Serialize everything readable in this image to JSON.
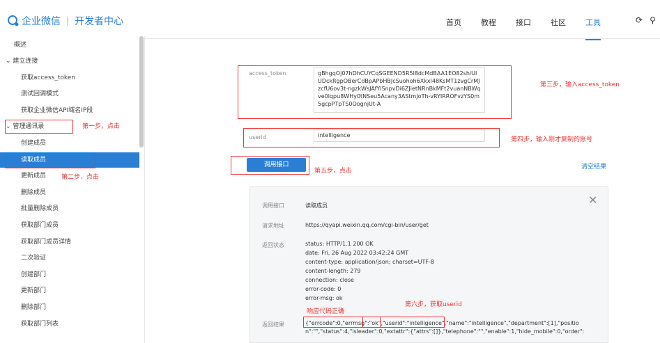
{
  "header": {
    "brand": "企业微信",
    "product": "开发者中心",
    "nav": [
      "首页",
      "教程",
      "接口",
      "社区",
      "工具"
    ],
    "active_nav": "工具"
  },
  "sidebar": {
    "items": [
      {
        "label": "概述",
        "level": 0
      },
      {
        "label": "建立连接",
        "level": "group",
        "chevron": "⌄"
      },
      {
        "label": "获取access_token",
        "level": 1
      },
      {
        "label": "测试回调模式",
        "level": 1
      },
      {
        "label": "获取企业微信API域名IP段",
        "level": 1
      },
      {
        "label": "管理通讯录",
        "level": "group",
        "chevron": "⌄"
      },
      {
        "label": "创建成员",
        "level": 1
      },
      {
        "label": "读取成员",
        "level": 1,
        "active": true
      },
      {
        "label": "更新成员",
        "level": 1
      },
      {
        "label": "删除成员",
        "level": 1
      },
      {
        "label": "批量删除成员",
        "level": 1
      },
      {
        "label": "获取部门成员",
        "level": 1
      },
      {
        "label": "获取部门成员详情",
        "level": 1
      },
      {
        "label": "二次验证",
        "level": 1
      },
      {
        "label": "创建部门",
        "level": 1
      },
      {
        "label": "更新部门",
        "level": 1
      },
      {
        "label": "删除部门",
        "level": 1
      },
      {
        "label": "获取部门列表",
        "level": 1
      }
    ]
  },
  "form": {
    "access_token_label": "access_token",
    "access_token_value": "gBhgqOj07hDhCUYCqSGEEND5R5l8dcMdBAA1EO82shiUIUDckRgpOBerCdBpAPbHBJcSuohoh6Xkxl48KsMT1zvgCrMJzcfU6ov3t-ngzkWsJAfYlSnpvDi6ZJietNRnBkMFt2vuanNBWqve0lqpu8WHy0tNSeu5Acany3AStmJoTh-vRYIRROFvzYS0m5gcpPTpTS0OognjUt-A",
    "userid_label": "userid",
    "userid_value": "intelligence",
    "debug_button": "调用接口",
    "clear_link": "清空结果"
  },
  "annotations": {
    "step1": "第一步，点击",
    "step2": "第二步，点击",
    "step3": "第三步，输入access_token",
    "step4": "第四步，输入刚才复制的账号",
    "step5": "第五步，点击",
    "step6": "第六步，获取userid",
    "result_ok": "响应代码正确"
  },
  "result": {
    "api_label": "调用接口",
    "api_value": "读取成员",
    "url_label": "请求地址",
    "url_value": "https://qyapi.weixin.qq.com/cgi-bin/user/get",
    "status_label": "返回状态",
    "status_lines": [
      "status: HTTP/1.1 200 OK",
      "date: Fri, 26 Aug 2022 03:42:24 GMT",
      "content-type: application/json; charset=UTF-8",
      "content-length: 279",
      "connection: close",
      "error-code: 0",
      "error-msg: ok"
    ],
    "response_label": "返回结果",
    "response_p1": "{\"errcode\":0,\"errmsg\":\"ok\"",
    "response_p2": ",",
    "response_p3": "\"userid\":\"intelligence\"",
    "response_p4": ",\"name\":\"intelligence\",\"department\":[1],\"positio",
    "response_line2": "n\":\"\",\"status\":4,\"isleader\":0,\"extattr\":{\"attrs\":[]},\"telephone\":\"\",\"enable\":1,\"hide_mobile\":0,\"order\":"
  },
  "colors": {
    "accent": "#2a7fd4",
    "annotation_red": "#e33"
  }
}
